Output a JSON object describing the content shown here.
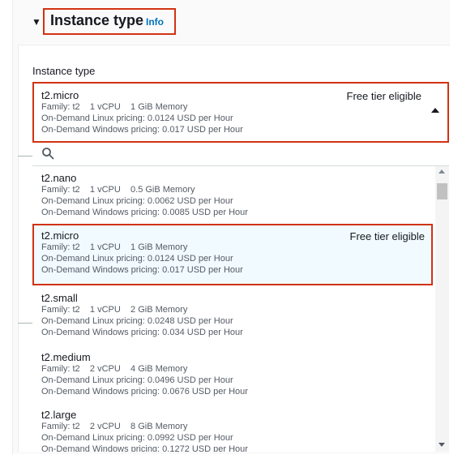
{
  "section": {
    "title": "Instance type",
    "info_link": "Info"
  },
  "field": {
    "label": "Instance type"
  },
  "selected": {
    "name": "t2.micro",
    "family_line": "Family: t2    1 vCPU    1 GiB Memory",
    "linux_line": "On-Demand Linux pricing: 0.0124 USD per Hour",
    "windows_line": "On-Demand Windows pricing: 0.017 USD per Hour",
    "badge": "Free tier eligible"
  },
  "search": {
    "value": "",
    "icon": "search-icon"
  },
  "options": [
    {
      "name": "t2.nano",
      "family_line": "Family: t2    1 vCPU    0.5 GiB Memory",
      "linux_line": "On-Demand Linux pricing: 0.0062 USD per Hour",
      "windows_line": "On-Demand Windows pricing: 0.0085 USD per Hour",
      "badge": ""
    },
    {
      "name": "t2.micro",
      "family_line": "Family: t2    1 vCPU    1 GiB Memory",
      "linux_line": "On-Demand Linux pricing: 0.0124 USD per Hour",
      "windows_line": "On-Demand Windows pricing: 0.017 USD per Hour",
      "badge": "Free tier eligible"
    },
    {
      "name": "t2.small",
      "family_line": "Family: t2    1 vCPU    2 GiB Memory",
      "linux_line": "On-Demand Linux pricing: 0.0248 USD per Hour",
      "windows_line": "On-Demand Windows pricing: 0.034 USD per Hour",
      "badge": ""
    },
    {
      "name": "t2.medium",
      "family_line": "Family: t2    2 vCPU    4 GiB Memory",
      "linux_line": "On-Demand Linux pricing: 0.0496 USD per Hour",
      "windows_line": "On-Demand Windows pricing: 0.0676 USD per Hour",
      "badge": ""
    },
    {
      "name": "t2.large",
      "family_line": "Family: t2    2 vCPU    8 GiB Memory",
      "linux_line": "On-Demand Linux pricing: 0.0992 USD per Hour",
      "windows_line": "On-Demand Windows pricing: 0.1272 USD per Hour",
      "badge": ""
    }
  ],
  "colors": {
    "highlight_border": "#d13212",
    "link": "#0073bb",
    "hover_bg": "#f1faff"
  }
}
